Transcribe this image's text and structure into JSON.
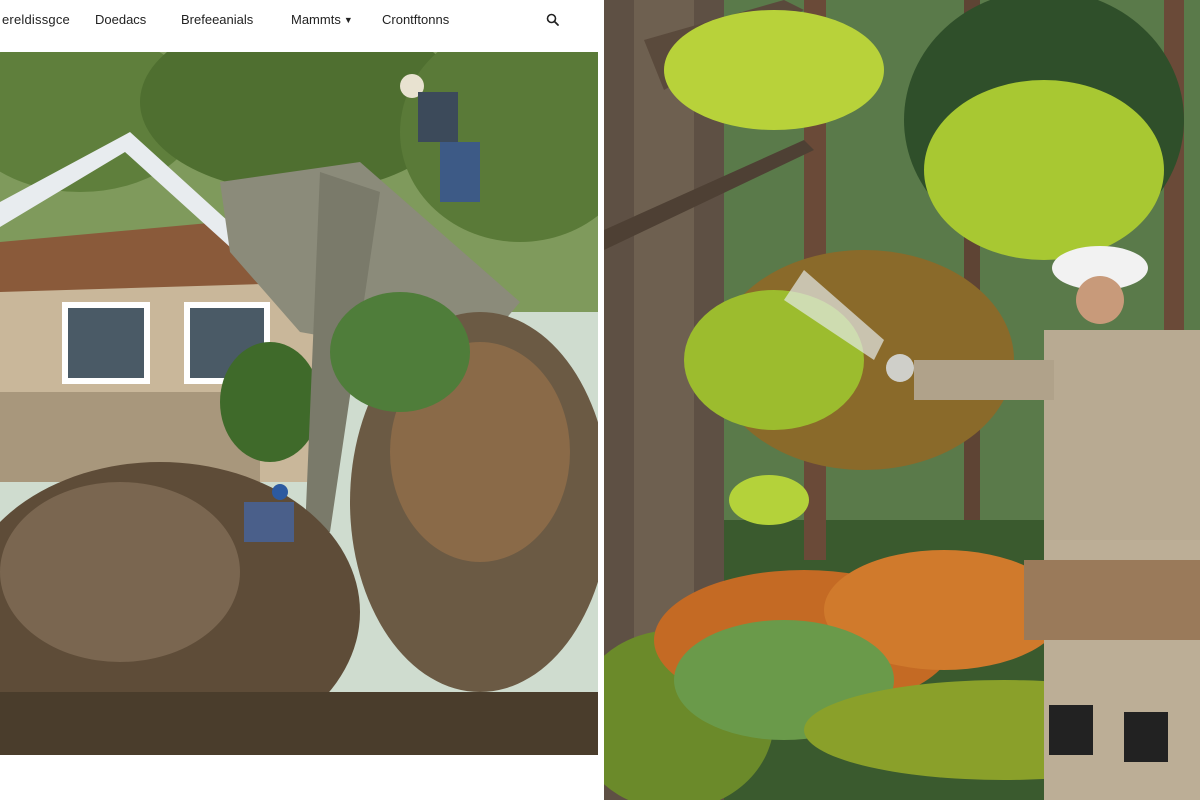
{
  "nav": {
    "logo": "ereldissgce",
    "items": [
      {
        "label": "Doedacs",
        "has_dropdown": false
      },
      {
        "label": "Brefeeanials",
        "has_dropdown": false
      },
      {
        "label": "Mammts",
        "has_dropdown": true
      },
      {
        "label": "Crontftonns",
        "has_dropdown": false
      }
    ],
    "search_icon": "search-icon"
  },
  "left_photo": {
    "subject": "crew removing a fallen uprooted tree from a damaged house"
  },
  "right_photo": {
    "subject": "arborist in white hard hat spraying treatment on a maple tree in a forest"
  },
  "colors": {
    "nav_text": "#222222",
    "background": "#ffffff"
  }
}
